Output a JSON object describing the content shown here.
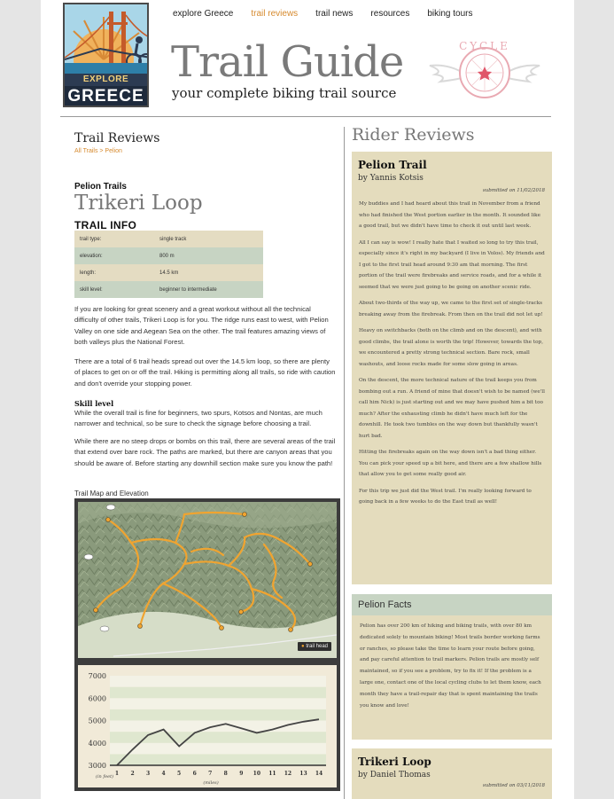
{
  "logo": {
    "line1": "EXPLORE",
    "line2": "GREECE"
  },
  "nav": [
    {
      "label": "explore Greece",
      "active": false
    },
    {
      "label": "trail reviews",
      "active": true
    },
    {
      "label": "trail news",
      "active": false
    },
    {
      "label": "resources",
      "active": false
    },
    {
      "label": "biking tours",
      "active": false
    }
  ],
  "site": {
    "title": "Trail Guide",
    "tagline": "your complete biking trail source",
    "badge": "CYCLE"
  },
  "colors": {
    "accent": "#d68a2e",
    "tan": "#e4dcbd",
    "sage": "#c7d4c3",
    "trail": "#f0a430"
  },
  "left": {
    "section_title": "Trail Reviews",
    "breadcrumb": "All Trails > Pelion",
    "region": "Pelion Trails",
    "trail_name": "Trikeri Loop",
    "info_heading": "TRAIL INFO",
    "info": [
      {
        "label": "trail type:",
        "value": "single track"
      },
      {
        "label": "elevation:",
        "value": "800 m"
      },
      {
        "label": "length:",
        "value": "14.5 km"
      },
      {
        "label": "skill level:",
        "value": "beginner to intermediate"
      }
    ],
    "para1": "If you are looking for great scenery and a great workout without all the technical difficulty of other trails, Trikeri Loop is for you. The ridge runs east to west, with Pelion Valley on one side and Aegean Sea on the other. The trail features amazing views of both valleys plus the National Forest.",
    "para2": "There are a total of 6 trail heads spread out over the 14.5 km loop, so there are plenty of places to get on or off the trail. Hiking is permitting along all trails, so ride with caution and don't override your stopping power.",
    "skill_heading": "Skill level",
    "para3": "While the overall trail is fine for beginners, two spurs, Kotsos and Nontas, are much narrower and technical, so be sure to check the signage before choosing a trail.",
    "para4": "While there are no steep drops or bombs on this trail, there are several areas of the trail that extend over bare rock. The paths are marked, but there are canyon areas that you should be aware of. Before starting any downhill section make sure you know the path!",
    "map_label": "Trail Map and Elevation",
    "map_legend": "trail head"
  },
  "chart_data": {
    "type": "line",
    "x": [
      1,
      2,
      3,
      4,
      5,
      6,
      7,
      8,
      9,
      10,
      11,
      12,
      13,
      14
    ],
    "categories": [
      "1",
      "2",
      "3",
      "4",
      "5",
      "6",
      "7",
      "8",
      "9",
      "10",
      "11",
      "12",
      "13",
      "14"
    ],
    "series": [
      {
        "values": [
          3000,
          3700,
          4350,
          4600,
          3850,
          4450,
          4700,
          4850,
          4650,
          4450,
          4600,
          4800,
          4950,
          5050
        ]
      }
    ],
    "ylim": [
      3000,
      7000
    ],
    "yticks": [
      "7000",
      "6000",
      "5000",
      "4000",
      "3000"
    ],
    "ylabel": "(in feet)",
    "xlabel": "(miles)",
    "grid": true
  },
  "right": {
    "heading": "Rider Reviews",
    "review1": {
      "title": "Pelion Trail",
      "author": "by Yannis Kotsis",
      "submitted": "submitted on 11/02/2018",
      "paras": [
        "My buddies and I had heard about this trail in November from a friend who had finished the West portion earlier in the month. It sounded like a good trail, but we didn't have time to check it out until last week.",
        "All I can say is wow! I really hate that I waited so long to try this trail, especially since it's right in my backyard (I live in Volos). My friends and I got to the first trail head around 9:30 am that morning. The first portion of the trail were firebreaks and service roads, and for a while it seemed that we were just going to be going on another scenic ride.",
        "About two-thirds of the way up, we came to the first set of single-tracks breaking away from the firebreak. From then on the trail did not let up!",
        "Heavy on switchbacks (both on the climb and on the descent), and with good climbs, the trail alone is worth the trip! However, towards the top, we encountered a pretty strong technical section. Bare rock, small washouts, and loose rocks made for some slow going in areas.",
        "On the descent, the more technical nature of the trail keeps you from bombing out a run. A friend of mine that doesn't wish to be named (we'll call him Nick) is just starting out and we may have pushed him a bit too much? After the exhausting climb he didn't have much left for the downhill. He took two tumbles on the way down but thankfully wasn't hurt bad.",
        "Hitting the firebreaks again on the way down isn't a bad thing either. You can pick your speed up a bit here, and there are a few shallow hills that allow you to get some really good air.",
        "For this trip we just did the West trail. I'm really looking forward to going back in a few weeks to do the East trail as well!"
      ]
    },
    "facts": {
      "heading": "Pelion Facts",
      "text": "Pelion has over 200 km of hiking and biking trails, with over 80 km dedicated solely to mountain biking! Most trails border working farms or ranches, so please take the time to learn your route before going, and pay careful attention to trail markers. Pelion trails are mostly self maintained, so if you see a problem, try to fix it! If the problem is a large one, contact one of the local cycling clubs to let them know, each month they have a trail-repair day that is spent maintaining the trails you know and love!"
    },
    "review2": {
      "title": "Trikeri Loop",
      "author": "by Daniel Thomas",
      "submitted": "submitted on 03/11/2018"
    }
  }
}
